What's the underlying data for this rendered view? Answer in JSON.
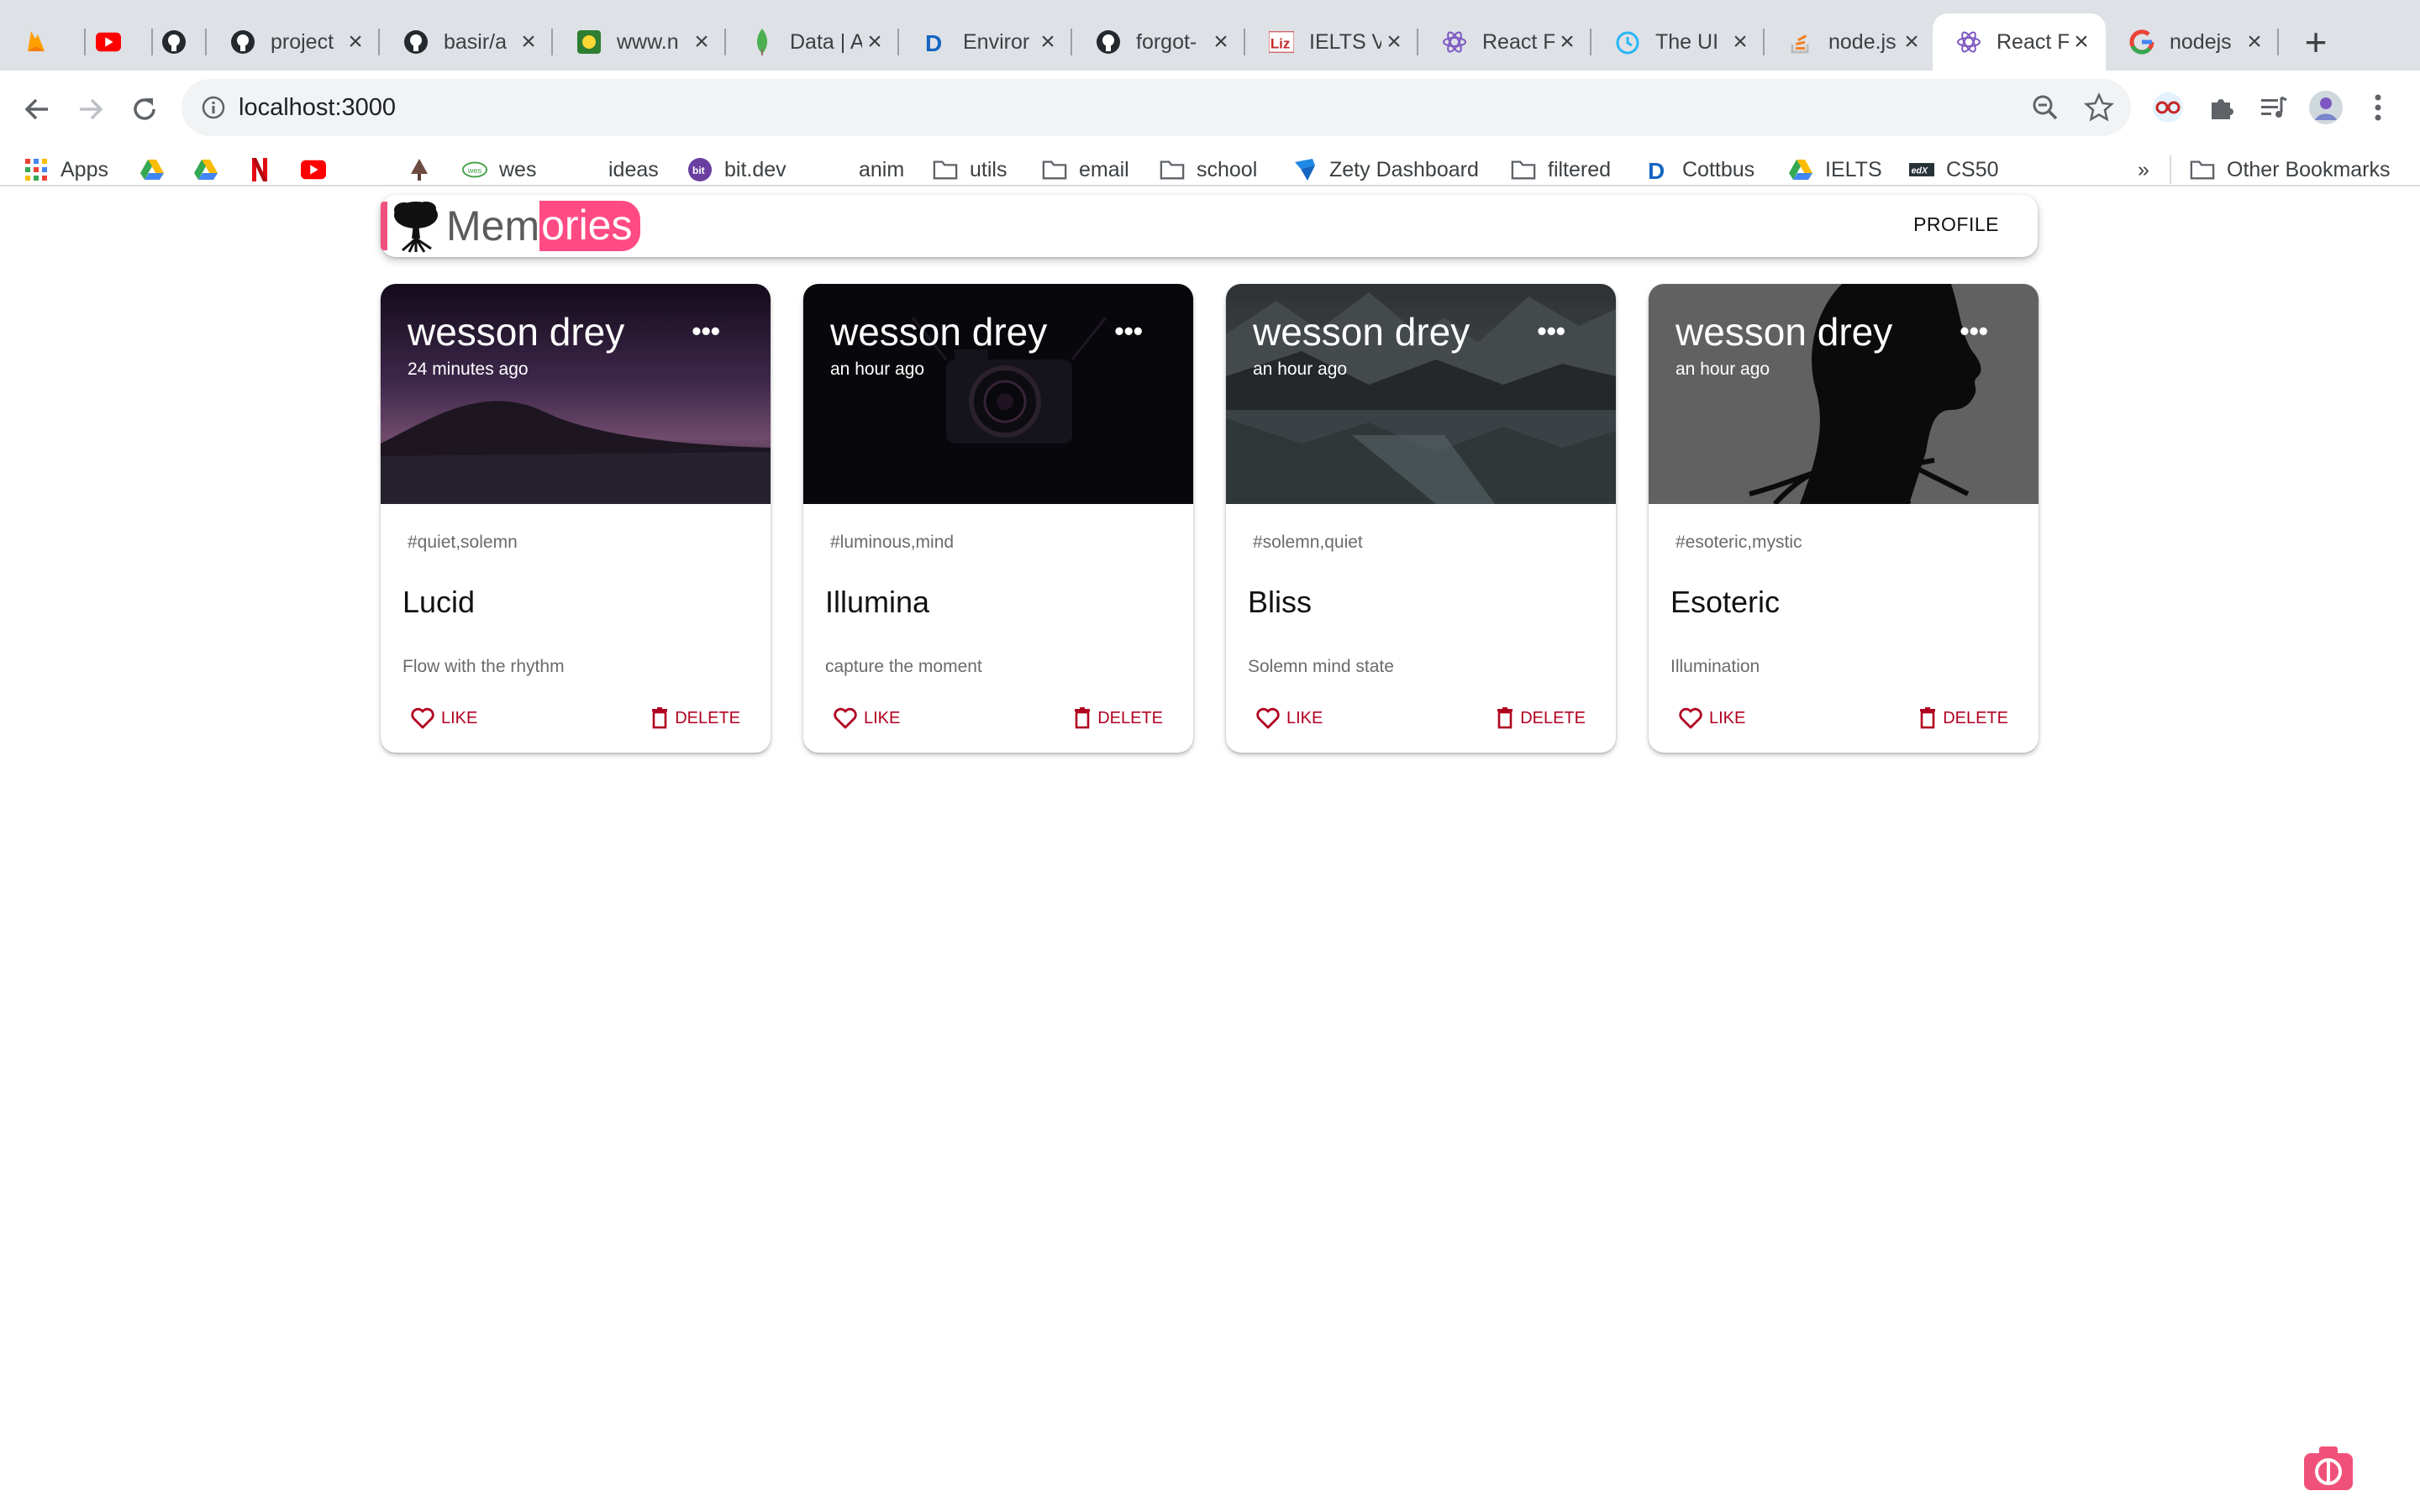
{
  "browser": {
    "tabs": [
      {
        "title": "",
        "icon": "firebase-icon"
      },
      {
        "title": "",
        "icon": "youtube-icon"
      },
      {
        "title": "",
        "icon": "github-icon"
      },
      {
        "title": "project",
        "icon": "github-icon"
      },
      {
        "title": "basir/a",
        "icon": "github-icon"
      },
      {
        "title": "www.n",
        "icon": "site-icon"
      },
      {
        "title": "Data | A",
        "icon": "mongodb-leaf-icon"
      },
      {
        "title": "Enviror",
        "icon": "d-icon"
      },
      {
        "title": "forgot-",
        "icon": "github-icon"
      },
      {
        "title": "IELTS V",
        "icon": "liz-icon"
      },
      {
        "title": "React F",
        "icon": "react-hook-form-icon"
      },
      {
        "title": "The UI",
        "icon": "clock-icon"
      },
      {
        "title": "node.js",
        "icon": "stackoverflow-icon"
      },
      {
        "title": "React F",
        "icon": "react-hook-form-icon"
      },
      {
        "title": "nodejs",
        "icon": "google-icon"
      }
    ],
    "active_tab_index": 13,
    "url": "localhost:3000",
    "bookmarks": [
      {
        "label": "Apps",
        "icon": "apps-grid-icon"
      },
      {
        "label": "",
        "icon": "drive-icon"
      },
      {
        "label": "",
        "icon": "drive-icon"
      },
      {
        "label": "",
        "icon": "netflix-icon"
      },
      {
        "label": "",
        "icon": "youtube-icon"
      },
      {
        "label": "",
        "icon": "tree-icon"
      },
      {
        "label": "wes",
        "icon": "wes-icon"
      },
      {
        "label": "ideas",
        "icon": "blank-icon"
      },
      {
        "label": "bit.dev",
        "icon": "bit-icon"
      },
      {
        "label": "anim",
        "icon": "blank-icon"
      },
      {
        "label": "utils",
        "icon": "folder-icon"
      },
      {
        "label": "email",
        "icon": "folder-icon"
      },
      {
        "label": "school",
        "icon": "folder-icon"
      },
      {
        "label": "Zety Dashboard",
        "icon": "zety-icon"
      },
      {
        "label": "filtered",
        "icon": "folder-icon"
      },
      {
        "label": "Cottbus",
        "icon": "d-icon"
      },
      {
        "label": "IELTS",
        "icon": "drive-icon"
      },
      {
        "label": "CS50",
        "icon": "cs50-icon"
      }
    ],
    "overflow_chevron": "»",
    "other_bookmarks": "Other Bookmarks"
  },
  "app": {
    "brand_prefix": "Mem",
    "brand_suffix": "ories",
    "profile_label": "PROFILE",
    "accent_color": "#ff4a84",
    "action_color": "#b00020"
  },
  "posts": [
    {
      "author": "wesson drey",
      "time": "24 minutes ago",
      "tags": "#quiet,solemn",
      "title": "Lucid",
      "message": "Flow with the rhythm",
      "like_label": "LIKE",
      "delete_label": "DELETE",
      "image": "purple-dusk-coastline"
    },
    {
      "author": "wesson drey",
      "time": "an hour ago",
      "tags": "#luminous,mind",
      "title": "Illumina",
      "message": "capture the moment",
      "like_label": "LIKE",
      "delete_label": "DELETE",
      "image": "dark-retro-camera"
    },
    {
      "author": "wesson drey",
      "time": "an hour ago",
      "tags": "#solemn,quiet",
      "title": "Bliss",
      "message": "Solemn mind state",
      "like_label": "LIKE",
      "delete_label": "DELETE",
      "image": "mountain-lake-reflection"
    },
    {
      "author": "wesson drey",
      "time": "an hour ago",
      "tags": "#esoteric,mystic",
      "title": "Esoteric",
      "message": "Illumination",
      "like_label": "LIKE",
      "delete_label": "DELETE",
      "image": "silhouette-tree-roots"
    }
  ]
}
